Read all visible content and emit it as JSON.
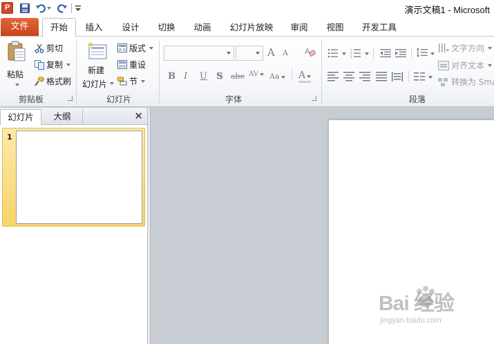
{
  "window": {
    "title": "演示文稿1 - Microsoft",
    "app_icon_letter": "P"
  },
  "tabs": {
    "file": "文件",
    "items": [
      {
        "label": "开始",
        "active": true
      },
      {
        "label": "插入"
      },
      {
        "label": "设计"
      },
      {
        "label": "切换"
      },
      {
        "label": "动画"
      },
      {
        "label": "幻灯片放映"
      },
      {
        "label": "审阅"
      },
      {
        "label": "视图"
      },
      {
        "label": "开发工具"
      }
    ]
  },
  "ribbon": {
    "clipboard": {
      "label": "剪贴板",
      "paste": "粘贴",
      "cut": "剪切",
      "copy": "复制",
      "format_painter": "格式刷"
    },
    "slides": {
      "label": "幻灯片",
      "new_slide_line1": "新建",
      "new_slide_line2": "幻灯片",
      "layout": "版式",
      "reset": "重设",
      "section": "节"
    },
    "font": {
      "label": "字体",
      "font_name": "",
      "font_size": "",
      "bold": "B",
      "italic": "I",
      "underline": "U",
      "shadow": "S",
      "strike": "abe",
      "spacing": "AV",
      "case": "Aa",
      "color": "A",
      "grow": "A",
      "shrink": "A"
    },
    "paragraph": {
      "label": "段落",
      "text_direction": "文字方向",
      "align_text": "对齐文本",
      "convert_smartart": "转换为 Sma"
    }
  },
  "left_panel": {
    "tab_slides": "幻灯片",
    "tab_outline": "大纲",
    "close": "✕",
    "slides": [
      {
        "number": "1"
      }
    ]
  },
  "watermark": {
    "main": "Bai 经验",
    "sub": "jingyan.baidu.com"
  },
  "colors": {
    "file_tab": "#d24726",
    "selection": "#f8d36a"
  }
}
